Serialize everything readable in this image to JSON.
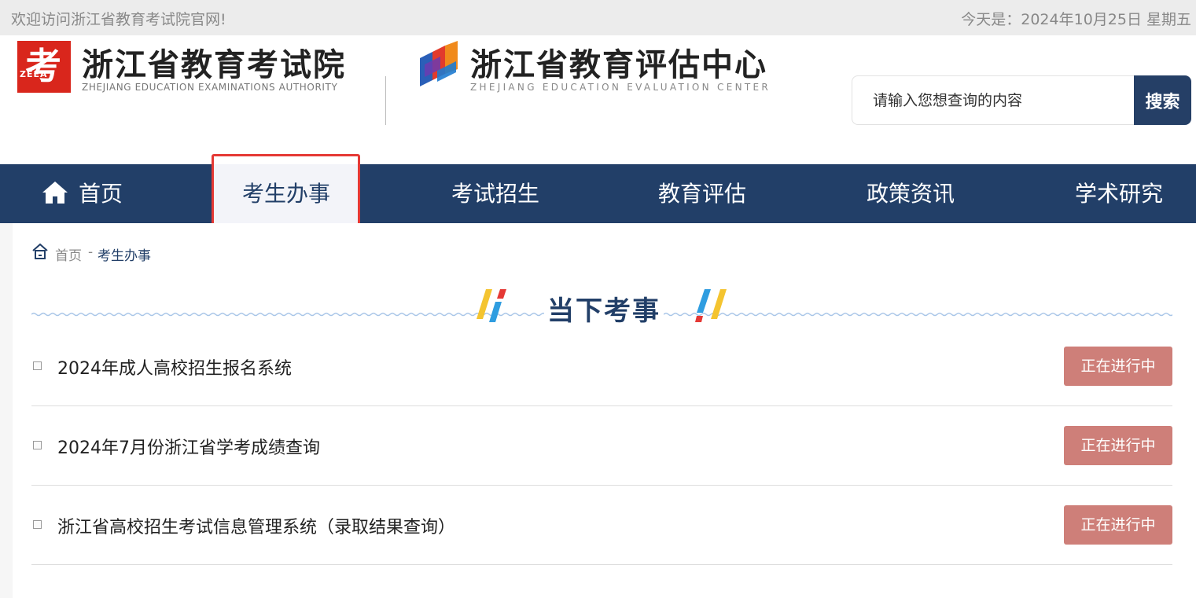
{
  "topbar": {
    "welcome": "欢迎访问浙江省教育考试院官网!",
    "date": "今天是：2024年10月25日 星期五"
  },
  "logo1": {
    "mark_glyph": "考",
    "mark_text": "ZEEA",
    "mark_small": "Zhejiang Education Examinations Authority",
    "cn": "浙江省教育考试院",
    "en": "ZHEJIANG EDUCATION EXAMINATIONS AUTHORITY",
    "mark_color": "#d9261c"
  },
  "logo2": {
    "cn": "浙江省教育评估中心",
    "en": "ZHEJIANG EDUCATION EVALUATION CENTER"
  },
  "search": {
    "placeholder": "请输入您想查询的内容",
    "button": "搜索"
  },
  "nav": {
    "items": [
      {
        "label": "首页"
      },
      {
        "label": "考生办事"
      },
      {
        "label": "考试招生"
      },
      {
        "label": "教育评估"
      },
      {
        "label": "政策资讯"
      },
      {
        "label": "学术研究"
      }
    ],
    "active_index": 1,
    "bg_color": "#223f68"
  },
  "breadcrumb": {
    "home": "首页",
    "separator": "-",
    "current": "考生办事"
  },
  "section": {
    "title": "当下考事"
  },
  "items": [
    {
      "title": "2024年成人高校招生报名系统",
      "status": "正在进行中"
    },
    {
      "title": "2024年7月份浙江省学考成绩查询",
      "status": "正在进行中"
    },
    {
      "title": "浙江省高校招生考试信息管理系统（录取结果查询）",
      "status": "正在进行中"
    }
  ],
  "colors": {
    "badge": "#ce7f79",
    "highlight_border": "#e53935"
  }
}
